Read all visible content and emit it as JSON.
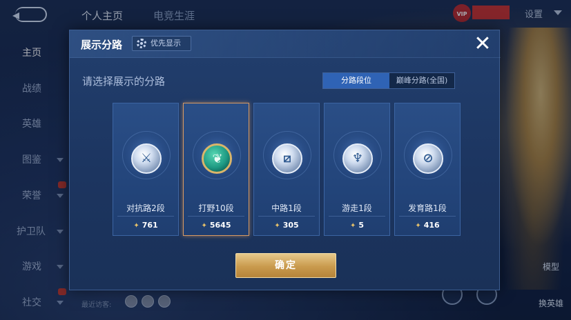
{
  "topbar": {
    "tabs": [
      "个人主页",
      "电竞生涯"
    ],
    "vip_label": "VIP",
    "settings_label": "设置"
  },
  "sidebar": {
    "items": [
      {
        "label": "主页",
        "active": true,
        "has_caret": false,
        "badge": false
      },
      {
        "label": "战绩",
        "active": false,
        "has_caret": false,
        "badge": false
      },
      {
        "label": "英雄",
        "active": false,
        "has_caret": false,
        "badge": false
      },
      {
        "label": "图鉴",
        "active": false,
        "has_caret": true,
        "badge": false
      },
      {
        "label": "荣誉",
        "active": false,
        "has_caret": true,
        "badge": true
      },
      {
        "label": "护卫队",
        "active": false,
        "has_caret": true,
        "badge": false
      },
      {
        "label": "游戏",
        "active": false,
        "has_caret": true,
        "badge": false
      },
      {
        "label": "社交",
        "active": false,
        "has_caret": true,
        "badge": true
      }
    ]
  },
  "recent_visitors_label": "最近访客:",
  "right_bottom": {
    "model_label": "模型",
    "switch_hero_label": "换英雄"
  },
  "modal": {
    "title": "展示分路",
    "priority_button_label": "优先显示",
    "prompt": "请选择展示的分路",
    "segments": [
      {
        "label": "分路段位",
        "active": true
      },
      {
        "label": "巅峰分路(全国)",
        "active": false
      }
    ],
    "lanes": [
      {
        "name": "对抗路2段",
        "score": "761",
        "selected": false,
        "icon": "clash-lane-icon"
      },
      {
        "name": "打野10段",
        "score": "5645",
        "selected": true,
        "icon": "jungle-icon"
      },
      {
        "name": "中路1段",
        "score": "305",
        "selected": false,
        "icon": "mid-lane-icon"
      },
      {
        "name": "游走1段",
        "score": "5",
        "selected": false,
        "icon": "roam-icon"
      },
      {
        "name": "发育路1段",
        "score": "416",
        "selected": false,
        "icon": "farm-lane-icon"
      }
    ],
    "confirm_label": "确定"
  },
  "colors": {
    "modal_bg": "#1c3560",
    "active_segment": "#2f63b5",
    "selected_border": "#d89a62",
    "confirm_gold": "#c99a4d"
  }
}
